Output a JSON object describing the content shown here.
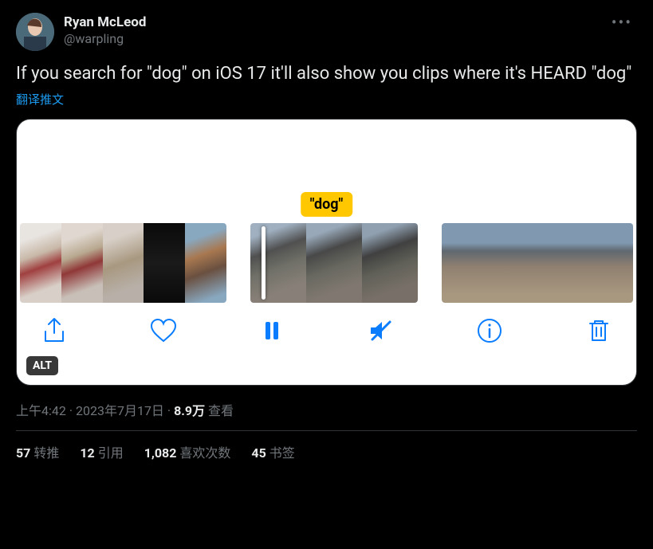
{
  "user": {
    "name": "Ryan McLeod",
    "handle": "@warpling"
  },
  "tweet_text": "If you search for \"dog\" on iOS 17 it'll also show you clips where it's HEARD \"dog\"",
  "translate_label": "翻译推文",
  "media": {
    "search_tag": "\"dog\"",
    "alt_badge": "ALT",
    "actions": {
      "share": "share",
      "like": "like",
      "pause": "pause",
      "mute": "mute",
      "info": "info",
      "delete": "delete"
    }
  },
  "meta": {
    "time": "上午4:42",
    "separator": " · ",
    "date": "2023年7月17日",
    "views_count": "8.9万",
    "views_label": " 查看"
  },
  "stats": {
    "retweets": {
      "count": "57",
      "label": "转推"
    },
    "quotes": {
      "count": "12",
      "label": "引用"
    },
    "likes": {
      "count": "1,082",
      "label": "喜欢次数"
    },
    "bookmarks": {
      "count": "45",
      "label": "书签"
    }
  }
}
